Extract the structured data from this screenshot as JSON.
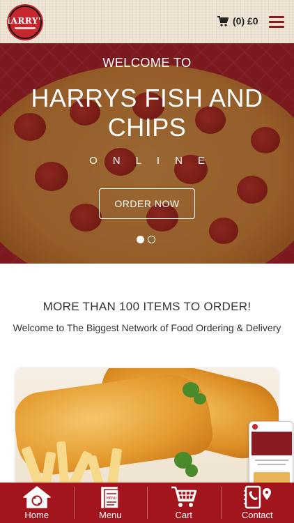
{
  "header": {
    "logo_text": "HARRY'S",
    "cart_label": "(0) £0"
  },
  "hero": {
    "welcome": "WELCOME TO",
    "title": "HARRYS FISH AND CHIPS",
    "subtitle": "ONLINE",
    "cta": "ORDER NOW",
    "slides": 2,
    "active_slide": 1
  },
  "content": {
    "headline": "MORE THAN 100 ITEMS TO ORDER!",
    "subline": "Welcome to The Biggest Network of Food Ordering & Delivery"
  },
  "bottom_nav": {
    "items": [
      {
        "label": "Home",
        "icon": "home-icon"
      },
      {
        "label": "Menu",
        "icon": "menu-book-icon"
      },
      {
        "label": "Cart",
        "icon": "cart-icon"
      },
      {
        "label": "Contact",
        "icon": "contact-icon"
      }
    ]
  },
  "colors": {
    "brand_red": "#a3151c",
    "header_bg": "#efe5d6"
  }
}
